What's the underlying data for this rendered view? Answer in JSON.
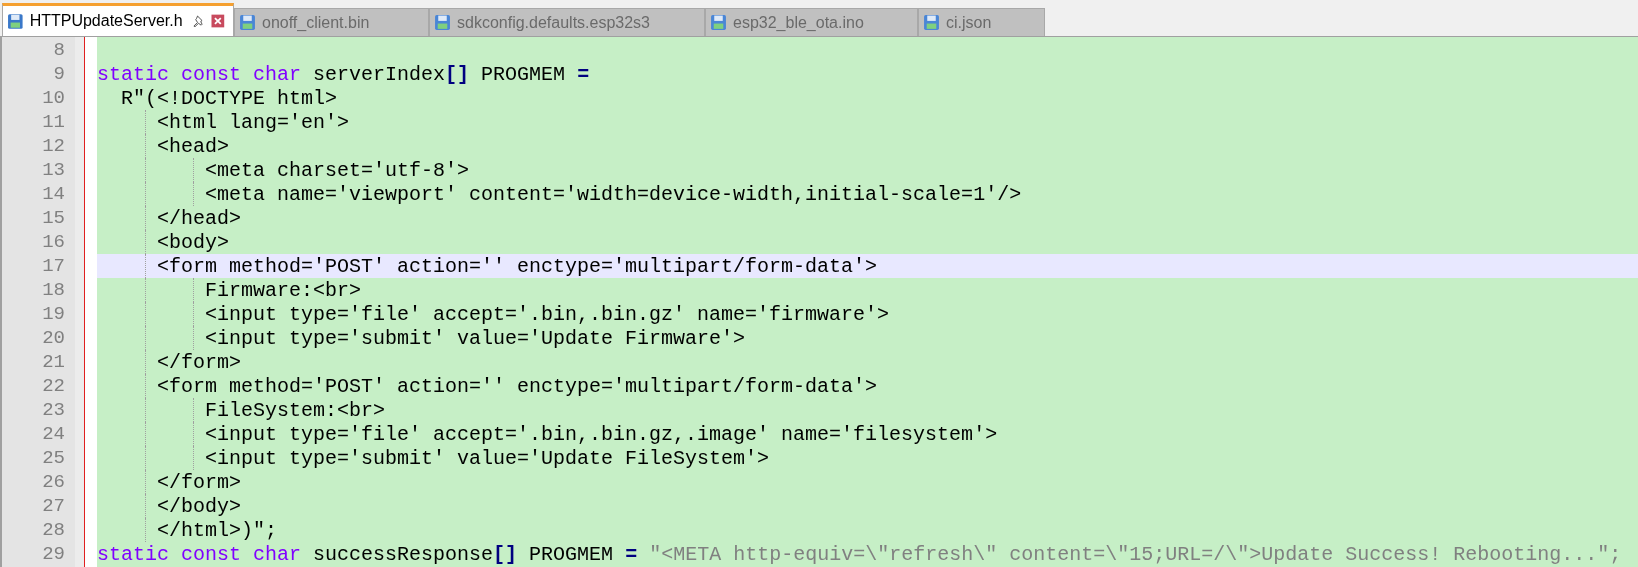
{
  "tabs": [
    {
      "label": "HTTPUpdateServer.h",
      "selected": true
    },
    {
      "label": "onoff_client.bin",
      "selected": false
    },
    {
      "label": "sdkconfig.defaults.esp32s3",
      "selected": false
    },
    {
      "label": "esp32_ble_ota.ino",
      "selected": false
    },
    {
      "label": "ci.json",
      "selected": false
    }
  ],
  "lines": [
    {
      "number": "8",
      "current": false
    },
    {
      "number": "9",
      "current": false,
      "tokens": [
        {
          "kind": "keyword",
          "text": "static const char"
        },
        {
          "kind": "plain",
          "text": " serverIndex"
        },
        {
          "kind": "operator",
          "text": "[]"
        },
        {
          "kind": "plain",
          "text": " PROGMEM "
        },
        {
          "kind": "operator",
          "text": "="
        }
      ]
    },
    {
      "number": "10",
      "current": false,
      "tokens": [
        {
          "kind": "plain",
          "text": "  R\"(<!DOCTYPE html>"
        }
      ]
    },
    {
      "number": "11",
      "current": false,
      "tokens": [
        {
          "kind": "plain",
          "text": "     <html lang='en'>"
        }
      ]
    },
    {
      "number": "12",
      "current": false,
      "tokens": [
        {
          "kind": "plain",
          "text": "     <head>"
        }
      ]
    },
    {
      "number": "13",
      "current": false,
      "tokens": [
        {
          "kind": "plain",
          "text": "         <meta charset='utf-8'>"
        }
      ]
    },
    {
      "number": "14",
      "current": false,
      "tokens": [
        {
          "kind": "plain",
          "text": "         <meta name='viewport' content='width=device-width,initial-scale=1'/>"
        }
      ]
    },
    {
      "number": "15",
      "current": false,
      "tokens": [
        {
          "kind": "plain",
          "text": "     </head>"
        }
      ]
    },
    {
      "number": "16",
      "current": false,
      "tokens": [
        {
          "kind": "plain",
          "text": "     <body>"
        }
      ]
    },
    {
      "number": "17",
      "current": true,
      "tokens": [
        {
          "kind": "plain",
          "text": "     <form method='POST' action='' enctype='multipart/form-data'>"
        }
      ]
    },
    {
      "number": "18",
      "current": false,
      "tokens": [
        {
          "kind": "plain",
          "text": "         Firmware:<br>"
        }
      ]
    },
    {
      "number": "19",
      "current": false,
      "tokens": [
        {
          "kind": "plain",
          "text": "         <input type='file' accept='.bin,.bin.gz' name='firmware'>"
        }
      ]
    },
    {
      "number": "20",
      "current": false,
      "tokens": [
        {
          "kind": "plain",
          "text": "         <input type='submit' value='Update Firmware'>"
        }
      ]
    },
    {
      "number": "21",
      "current": false,
      "tokens": [
        {
          "kind": "plain",
          "text": "     </form>"
        }
      ]
    },
    {
      "number": "22",
      "current": false,
      "tokens": [
        {
          "kind": "plain",
          "text": "     <form method='POST' action='' enctype='multipart/form-data'>"
        }
      ]
    },
    {
      "number": "23",
      "current": false,
      "tokens": [
        {
          "kind": "plain",
          "text": "         FileSystem:<br>"
        }
      ]
    },
    {
      "number": "24",
      "current": false,
      "tokens": [
        {
          "kind": "plain",
          "text": "         <input type='file' accept='.bin,.bin.gz,.image' name='filesystem'>"
        }
      ]
    },
    {
      "number": "25",
      "current": false,
      "tokens": [
        {
          "kind": "plain",
          "text": "         <input type='submit' value='Update FileSystem'>"
        }
      ]
    },
    {
      "number": "26",
      "current": false,
      "tokens": [
        {
          "kind": "plain",
          "text": "     </form>"
        }
      ]
    },
    {
      "number": "27",
      "current": false,
      "tokens": [
        {
          "kind": "plain",
          "text": "     </body>"
        }
      ]
    },
    {
      "number": "28",
      "current": false,
      "tokens": [
        {
          "kind": "plain",
          "text": "     </html>)\";"
        }
      ]
    },
    {
      "number": "29",
      "current": false,
      "tokens": [
        {
          "kind": "keyword",
          "text": "static const char"
        },
        {
          "kind": "plain",
          "text": " successResponse"
        },
        {
          "kind": "operator",
          "text": "[]"
        },
        {
          "kind": "plain",
          "text": " PROGMEM "
        },
        {
          "kind": "operator",
          "text": "="
        },
        {
          "kind": "string",
          "text": "\"<META http-equiv=\\\"refresh\\\" content=\\\"15;URL=/\\\">Update Success! Rebooting...\";"
        }
      ]
    }
  ]
}
